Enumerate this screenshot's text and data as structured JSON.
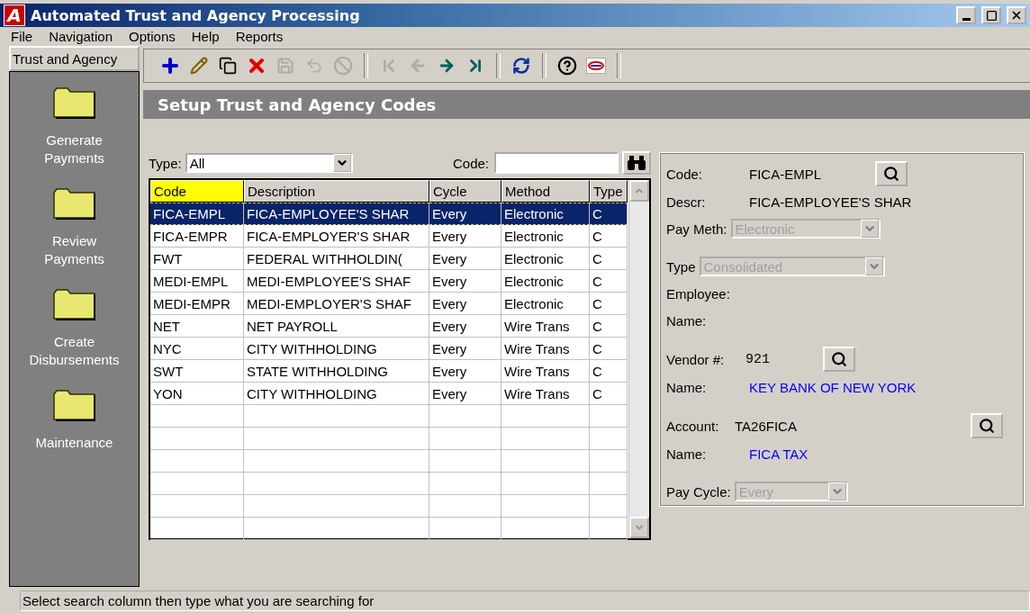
{
  "window": {
    "app_icon_letter": "A",
    "title": "Automated Trust and Agency Processing"
  },
  "menu": [
    "File",
    "Navigation",
    "Options",
    "Help",
    "Reports"
  ],
  "sidebar": {
    "title": "Trust and Agency",
    "items": [
      {
        "label": "Generate Payments"
      },
      {
        "label": "Review Payments"
      },
      {
        "label": "Create Disbursements"
      },
      {
        "label": "Maintenance"
      }
    ]
  },
  "toolbar": [
    {
      "kind": "add",
      "disabled": false
    },
    {
      "kind": "edit",
      "disabled": false
    },
    {
      "kind": "copy",
      "disabled": false
    },
    {
      "kind": "delete",
      "disabled": false
    },
    {
      "kind": "save",
      "disabled": true
    },
    {
      "kind": "undo",
      "disabled": true
    },
    {
      "kind": "cancel",
      "disabled": true
    },
    {
      "kind": "separator"
    },
    {
      "kind": "first",
      "disabled": true
    },
    {
      "kind": "prev",
      "disabled": true
    },
    {
      "kind": "next",
      "disabled": false
    },
    {
      "kind": "last",
      "disabled": false
    },
    {
      "kind": "separator"
    },
    {
      "kind": "refresh",
      "disabled": false
    },
    {
      "kind": "separator"
    },
    {
      "kind": "help",
      "disabled": false
    },
    {
      "kind": "logo",
      "disabled": false
    },
    {
      "kind": "separator"
    }
  ],
  "page_title": "Setup Trust and Agency Codes",
  "filter": {
    "type_label": "Type:",
    "type_value": "All",
    "code_label": "Code:"
  },
  "table": {
    "columns": [
      {
        "label": "Code",
        "selected": true
      },
      {
        "label": "Description",
        "selected": false
      },
      {
        "label": "Cycle",
        "selected": false
      },
      {
        "label": "Method",
        "selected": false
      },
      {
        "label": "Type",
        "selected": false
      }
    ],
    "rows": [
      {
        "cells": [
          "FICA-EMPL",
          "FICA-EMPLOYEE'S SHAR",
          "Every",
          "Electronic",
          "C"
        ],
        "selected": true
      },
      {
        "cells": [
          "FICA-EMPR",
          "FICA-EMPLOYER'S SHAR",
          "Every",
          "Electronic",
          "C"
        ],
        "selected": false
      },
      {
        "cells": [
          "FWT",
          "FEDERAL WITHHOLDIN(",
          "Every",
          "Electronic",
          "C"
        ],
        "selected": false
      },
      {
        "cells": [
          "MEDI-EMPL",
          "MEDI-EMPLOYEE'S SHAF",
          "Every",
          "Electronic",
          "C"
        ],
        "selected": false
      },
      {
        "cells": [
          "MEDI-EMPR",
          "MEDI-EMPLOYER'S SHAF",
          "Every",
          "Electronic",
          "C"
        ],
        "selected": false
      },
      {
        "cells": [
          "NET",
          "NET PAYROLL",
          "Every",
          "Wire Trans",
          "C"
        ],
        "selected": false
      },
      {
        "cells": [
          "NYC",
          "CITY WITHHOLDING",
          "Every",
          "Wire Trans",
          "C"
        ],
        "selected": false
      },
      {
        "cells": [
          "SWT",
          "STATE WITHHOLDING",
          "Every",
          "Wire Trans",
          "C"
        ],
        "selected": false
      },
      {
        "cells": [
          "YON",
          "CITY WITHHOLDING",
          "Every",
          "Wire Trans",
          "C"
        ],
        "selected": false
      }
    ]
  },
  "detail": {
    "groups": [
      [
        {
          "kind": "text",
          "label": "Code:",
          "value": "FICA-EMPL",
          "lookup": true
        },
        {
          "kind": "text",
          "label": "Descr:",
          "value": "FICA-EMPLOYEE'S SHAR"
        },
        {
          "kind": "select",
          "label": "Pay Meth:",
          "value": "Electronic",
          "disabled": true
        }
      ],
      [
        {
          "kind": "select",
          "label": "Type",
          "value": "Consolidated",
          "disabled": true
        },
        {
          "kind": "blank",
          "label": "Employee:"
        },
        {
          "kind": "blank",
          "label": "Name:"
        }
      ],
      [
        {
          "kind": "number",
          "label": "Vendor #:",
          "value": "921",
          "lookup": true
        },
        {
          "kind": "name",
          "label": "Name:",
          "value": "KEY BANK OF NEW YORK"
        }
      ],
      [
        {
          "kind": "account",
          "label": "Account:",
          "value": "TA26FICA",
          "lookup": true
        },
        {
          "kind": "name",
          "label": "Name:",
          "value": "FICA TAX"
        }
      ],
      [
        {
          "kind": "select",
          "label": "Pay Cycle:",
          "value": "Every",
          "disabled": true
        }
      ]
    ]
  },
  "status_bar": "Select search column then type what you are searching for"
}
